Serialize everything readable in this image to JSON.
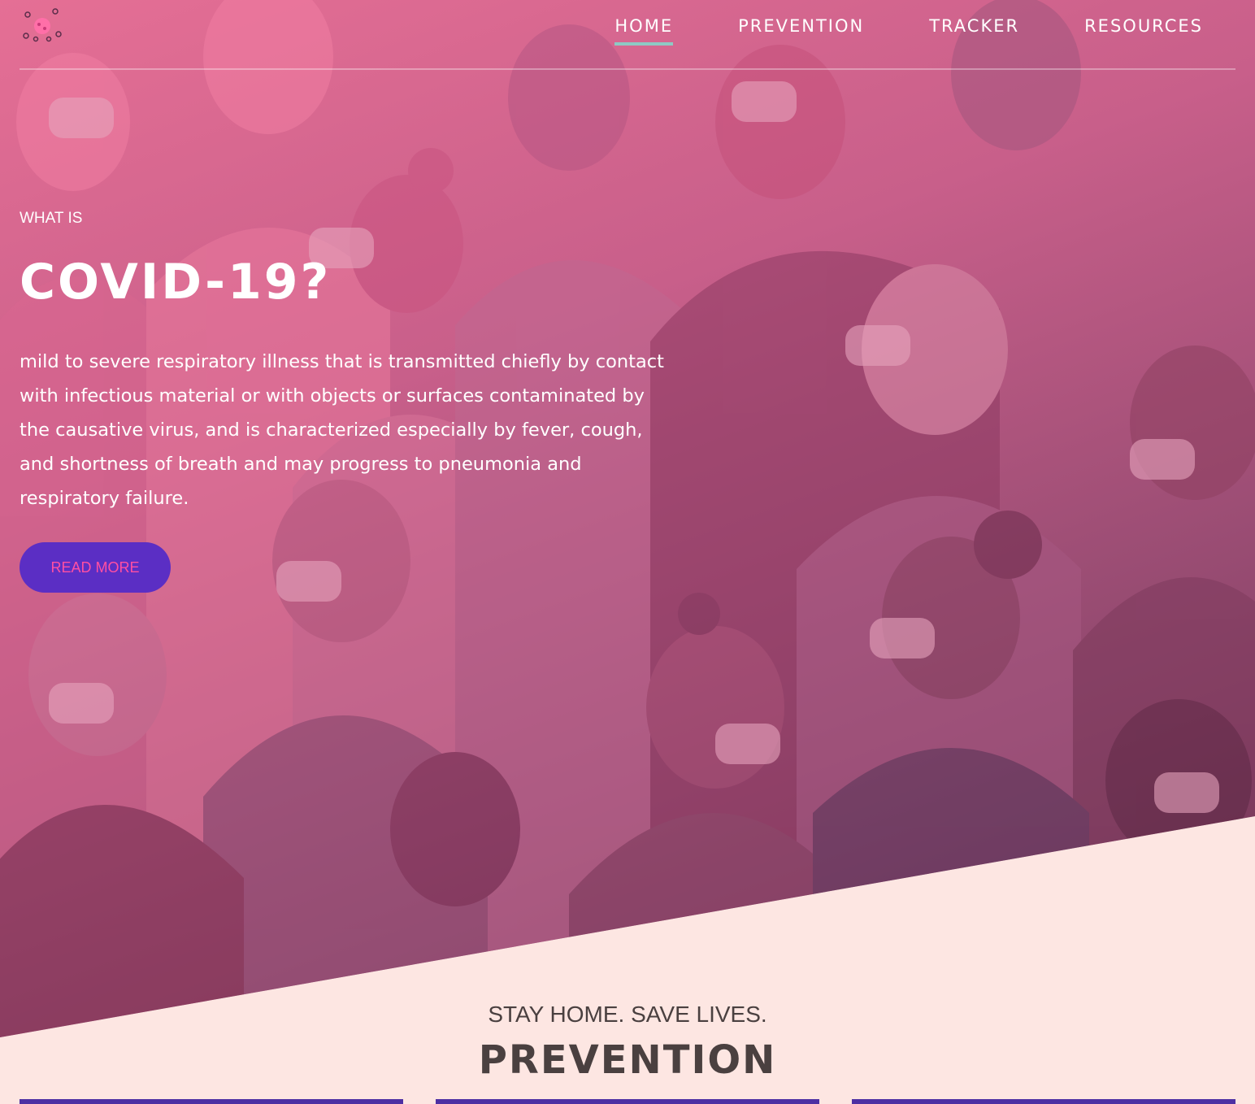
{
  "nav": {
    "logo_icon": "virus-icon",
    "items": [
      {
        "label": "HOME",
        "active": true
      },
      {
        "label": "PREVENTION",
        "active": false
      },
      {
        "label": "TRACKER",
        "active": false
      },
      {
        "label": "RESOURCES",
        "active": false
      }
    ]
  },
  "hero": {
    "eyebrow": "WHAT IS",
    "title": "COVID-19?",
    "description": "mild to severe respiratory illness that is transmitted chiefly by contact with infectious material or with objects or surfaces contaminated by the causative virus, and is characterized especially by fever, cough, and shortness of breath and may progress to pneumonia and respiratory failure.",
    "cta_label": "READ MORE"
  },
  "prevention": {
    "tagline": "STAY HOME. SAVE LIVES.",
    "title": "PREVENTION"
  },
  "colors": {
    "accent_underline": "#8ec9c4",
    "button_bg": "#5b2ec4",
    "button_text": "#ff4fa2",
    "section_bg": "#fde6e2",
    "card_bg": "#4d2fa3"
  }
}
